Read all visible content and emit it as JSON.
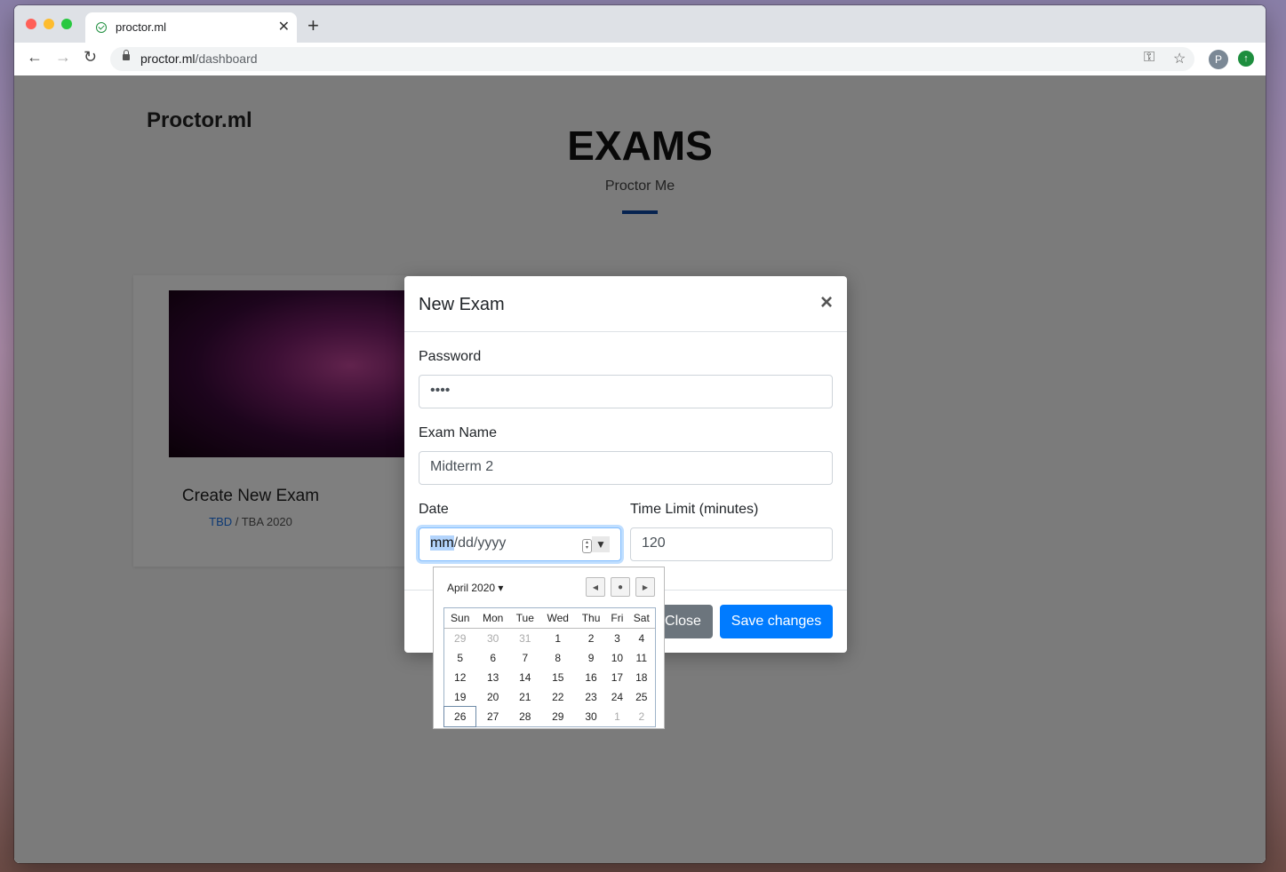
{
  "browser": {
    "tab_title": "proctor.ml",
    "url_host": "proctor.ml",
    "url_path": "/dashboard",
    "profile_initial": "P"
  },
  "page": {
    "brand": "Proctor.ml",
    "heading": "EXAMS",
    "subheading": "Proctor Me",
    "card": {
      "title": "Create New Exam",
      "tbd": "TBD",
      "meta": " / TBA 2020"
    }
  },
  "modal": {
    "title": "New Exam",
    "password_label": "Password",
    "password_value": "••••",
    "exam_name_label": "Exam Name",
    "exam_name_value": "Midterm 2",
    "date_label": "Date",
    "date_placeholder_mm": "mm",
    "date_placeholder_rest": "/dd/yyyy",
    "time_limit_label": "Time Limit (minutes)",
    "time_limit_value": "120",
    "close_label": "Close",
    "save_label": "Save changes"
  },
  "calendar": {
    "month_label": "April 2020",
    "weekdays": [
      "Sun",
      "Mon",
      "Tue",
      "Wed",
      "Thu",
      "Fri",
      "Sat"
    ],
    "weeks": [
      [
        "29",
        "30",
        "31",
        "1",
        "2",
        "3",
        "4"
      ],
      [
        "5",
        "6",
        "7",
        "8",
        "9",
        "10",
        "11"
      ],
      [
        "12",
        "13",
        "14",
        "15",
        "16",
        "17",
        "18"
      ],
      [
        "19",
        "20",
        "21",
        "22",
        "23",
        "24",
        "25"
      ],
      [
        "26",
        "27",
        "28",
        "29",
        "30",
        "1",
        "2"
      ]
    ],
    "today": "26"
  },
  "colors": {
    "primary_button": "#007bff",
    "secondary_button": "#6c757d",
    "accent_bar": "#0d47a1"
  }
}
